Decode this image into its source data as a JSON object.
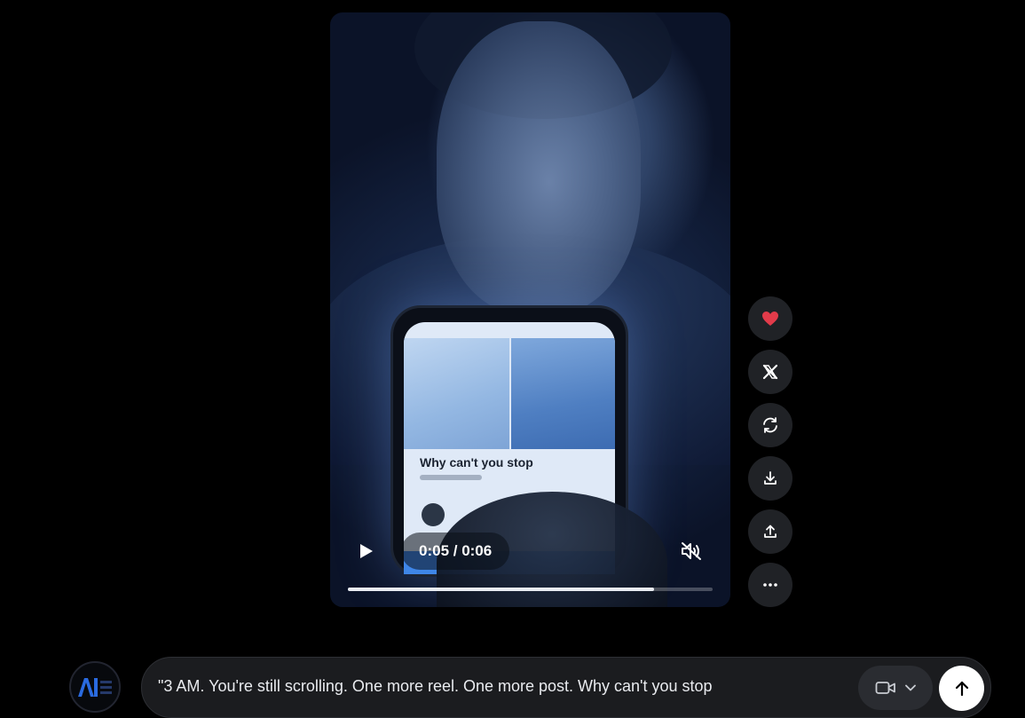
{
  "video": {
    "on_screen_caption": "Why can't you stop",
    "time_display": "0:05 / 0:06",
    "progress": 0.84,
    "muted": true
  },
  "side_actions": [
    {
      "name": "like",
      "icon": "heart-icon",
      "color": "#e23b4a"
    },
    {
      "name": "share-x",
      "icon": "x-logo-icon"
    },
    {
      "name": "regenerate",
      "icon": "refresh-icon"
    },
    {
      "name": "download",
      "icon": "download-icon"
    },
    {
      "name": "upload",
      "icon": "upload-icon"
    },
    {
      "name": "more",
      "icon": "more-icon"
    }
  ],
  "composer": {
    "prompt_text": "\"3 AM. You're still scrolling. One more reel. One more post. Why can't you stop",
    "mode_icon": "video-camera-icon",
    "send_icon": "arrow-up-icon"
  },
  "colors": {
    "background": "#000000",
    "button_bg": "#202226",
    "accent_heart": "#e23b4a"
  }
}
